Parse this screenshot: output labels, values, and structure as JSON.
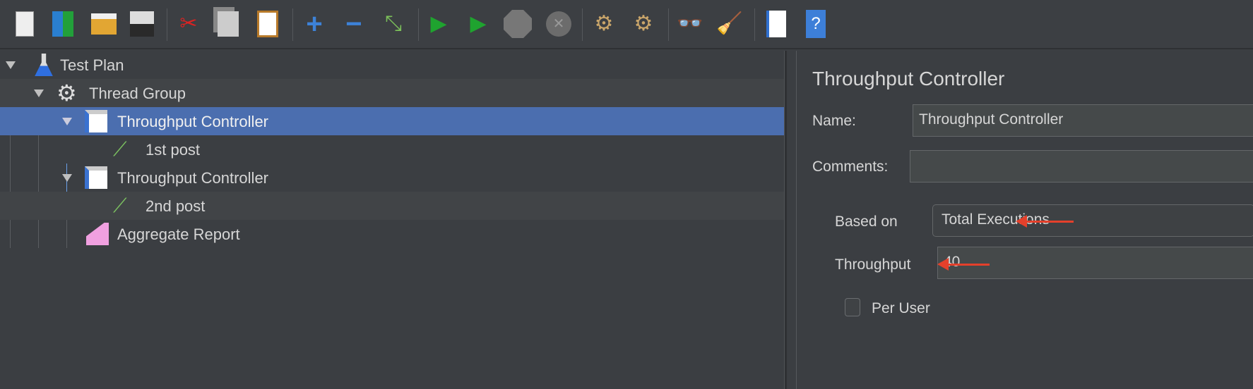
{
  "toolbar": {
    "buttons": [
      {
        "name": "new-icon"
      },
      {
        "name": "templates-icon"
      },
      {
        "name": "open-icon"
      },
      {
        "name": "save-icon"
      },
      {
        "name": "cut-icon"
      },
      {
        "name": "copy-icon"
      },
      {
        "name": "paste-icon"
      },
      {
        "name": "expand-icon"
      },
      {
        "name": "collapse-icon"
      },
      {
        "name": "toggle-icon"
      },
      {
        "name": "start-icon"
      },
      {
        "name": "start-no-pauses-icon"
      },
      {
        "name": "stop-icon"
      },
      {
        "name": "shutdown-icon"
      },
      {
        "name": "clear-icon"
      },
      {
        "name": "clear-all-icon"
      },
      {
        "name": "search-icon"
      },
      {
        "name": "reset-search-icon"
      },
      {
        "name": "function-helper-icon"
      },
      {
        "name": "help-icon"
      }
    ]
  },
  "tree": {
    "items": [
      {
        "label": "Test Plan",
        "icon": "test-plan-flask-icon"
      },
      {
        "label": "Thread Group",
        "icon": "thread-group-gear-icon"
      },
      {
        "label": "Throughput Controller",
        "icon": "controller-icon",
        "selected": true
      },
      {
        "label": "1st post",
        "icon": "sampler-pipette-icon"
      },
      {
        "label": "Throughput Controller",
        "icon": "controller-icon"
      },
      {
        "label": "2nd post",
        "icon": "sampler-pipette-icon"
      },
      {
        "label": "Aggregate Report",
        "icon": "listener-chart-icon"
      }
    ]
  },
  "panel": {
    "title": "Throughput Controller",
    "name_label": "Name:",
    "name_value": "Throughput Controller",
    "comments_label": "Comments:",
    "comments_value": "",
    "based_on_label": "Based on",
    "based_on_value": "Total Executions",
    "throughput_label": "Throughput",
    "throughput_value": "40",
    "per_user_label": "Per User",
    "per_user_checked": false
  },
  "colors": {
    "selection": "#4b6eaf",
    "annotation_arrow": "#e4402b",
    "background": "#3b3e42"
  }
}
